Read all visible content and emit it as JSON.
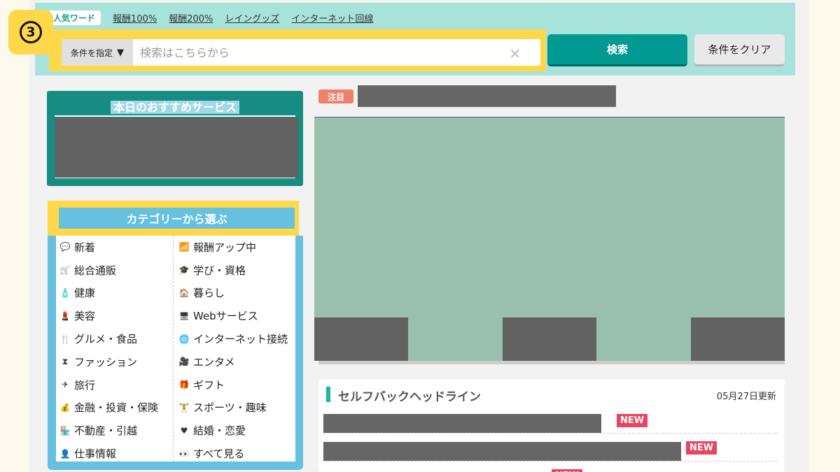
{
  "search": {
    "popular_label": "人気ワード",
    "popular_words": [
      "報酬100%",
      "報酬200%",
      "レイングッズ",
      "インターネット回線"
    ],
    "condition_label": "条件を指定",
    "condition_arrow": "▼",
    "placeholder": "検索はこちらから",
    "clear_icon": "×",
    "search_button": "検索",
    "clear_button": "条件をクリア"
  },
  "annotation": {
    "step_number": "3"
  },
  "recommend": {
    "title": "本日のおすすめサービス"
  },
  "category": {
    "title": "カテゴリーから選ぶ",
    "items": [
      {
        "label": "新着",
        "icon": "💬",
        "icon_name": "speech-bubble-icon"
      },
      {
        "label": "報酬アップ中",
        "icon": "📶",
        "icon_name": "bar-chart-icon"
      },
      {
        "label": "総合通販",
        "icon": "🛒",
        "icon_name": "cart-icon"
      },
      {
        "label": "学び・資格",
        "icon": "🎓",
        "icon_name": "graduation-cap-icon"
      },
      {
        "label": "健康",
        "icon": "🧴",
        "icon_name": "bottle-icon"
      },
      {
        "label": "暮らし",
        "icon": "🏠",
        "icon_name": "lamp-icon"
      },
      {
        "label": "美容",
        "icon": "💄",
        "icon_name": "lipstick-icon"
      },
      {
        "label": "Webサービス",
        "icon": "🖥",
        "icon_name": "monitor-icon"
      },
      {
        "label": "グルメ・食品",
        "icon": "🍴",
        "icon_name": "fork-knife-icon"
      },
      {
        "label": "インターネット接続",
        "icon": "🌐",
        "icon_name": "globe-icon"
      },
      {
        "label": "ファッション",
        "icon": "⧗",
        "icon_name": "dress-icon"
      },
      {
        "label": "エンタメ",
        "icon": "🎥",
        "icon_name": "video-camera-icon"
      },
      {
        "label": "旅行",
        "icon": "✈",
        "icon_name": "airplane-icon"
      },
      {
        "label": "ギフト",
        "icon": "🎁",
        "icon_name": "gift-icon"
      },
      {
        "label": "金融・投資・保険",
        "icon": "💰",
        "icon_name": "money-bag-icon"
      },
      {
        "label": "スポーツ・趣味",
        "icon": "🏋",
        "icon_name": "dumbbell-icon"
      },
      {
        "label": "不動産・引越",
        "icon": "🏪",
        "icon_name": "store-icon"
      },
      {
        "label": "結婚・恋愛",
        "icon": "♥",
        "icon_name": "heart-icon"
      },
      {
        "label": "仕事情報",
        "icon": "👤",
        "icon_name": "person-icon"
      },
      {
        "label": "すべて見る",
        "icon": "👀",
        "icon_name": "binoculars-icon"
      }
    ]
  },
  "featured": {
    "badge": "注目"
  },
  "headline": {
    "title": "セルフバックヘッドライン",
    "updated": "05月27日更新",
    "new_label": "NEW"
  },
  "colors": {
    "search_band": "#a8e3db",
    "highlight": "#ffd84a",
    "search_button": "#009a93",
    "recommend_bg": "#168c82",
    "category_bg": "#66c0e0",
    "featured_badge": "#f0806a",
    "new_badge": "#e84560"
  }
}
